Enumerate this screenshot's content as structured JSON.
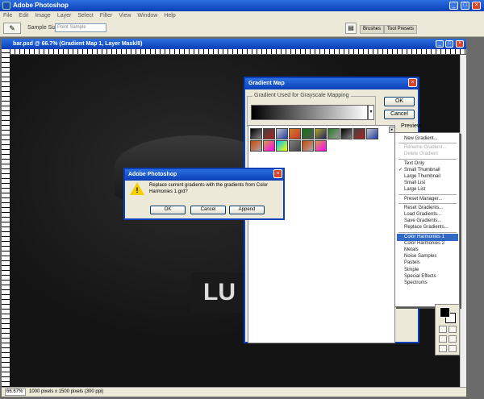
{
  "app": {
    "title": "Adobe Photoshop"
  },
  "menubar": [
    "File",
    "Edit",
    "Image",
    "Layer",
    "Select",
    "Filter",
    "View",
    "Window",
    "Help"
  ],
  "options": {
    "sample_size_label": "Sample Size:",
    "sample_size_value": "Point Sample",
    "tabs": [
      "Brushes",
      "Tool Presets"
    ]
  },
  "document": {
    "title": "bar.psd @ 66.7% (Gradient Map 1, Layer Mask/8)",
    "zoom": "66.67%",
    "info": "1000 pixels x 1500 pixels (300 ppi)",
    "sign_text": "LU"
  },
  "gradient_map": {
    "title": "Gradient Map",
    "group_label": "Gradient Used for Grayscale Mapping",
    "ok": "OK",
    "cancel": "Cancel",
    "preview": "Preview"
  },
  "swatches": {
    "row1": [
      "#000000",
      "#888888",
      "#444444",
      "#aa2222",
      "#c0c0c0",
      "#1f3faa",
      "#d08020",
      "#cc3333",
      "#117711",
      "#555555",
      "#aaaa22",
      "#222266",
      "#2a7a2a",
      "#999999"
    ],
    "row2": [
      "#cc4400",
      "#aaaaaa",
      "#d0a040",
      "#ff00ff",
      "#00c0ff",
      "#ffff00",
      "#808080",
      "#404040"
    ]
  },
  "menu": {
    "items": [
      {
        "label": "New Gradient...",
        "state": "normal"
      },
      {
        "sep": true
      },
      {
        "label": "Rename Gradient...",
        "state": "disabled"
      },
      {
        "label": "Delete Gradient",
        "state": "disabled"
      },
      {
        "sep": true
      },
      {
        "label": "Text Only",
        "state": "normal"
      },
      {
        "label": "Small Thumbnail",
        "state": "checked"
      },
      {
        "label": "Large Thumbnail",
        "state": "normal"
      },
      {
        "label": "Small List",
        "state": "normal"
      },
      {
        "label": "Large List",
        "state": "normal"
      },
      {
        "sep": true
      },
      {
        "label": "Preset Manager...",
        "state": "normal"
      },
      {
        "sep": true
      },
      {
        "label": "Reset Gradients...",
        "state": "normal"
      },
      {
        "label": "Load Gradients...",
        "state": "normal"
      },
      {
        "label": "Save Gradients...",
        "state": "normal"
      },
      {
        "label": "Replace Gradients...",
        "state": "normal"
      },
      {
        "sep": true
      },
      {
        "label": "Color Harmonies 1",
        "state": "selected"
      },
      {
        "label": "Color Harmonies 2",
        "state": "normal"
      },
      {
        "label": "Metals",
        "state": "normal"
      },
      {
        "label": "Noise Samples",
        "state": "normal"
      },
      {
        "label": "Pastels",
        "state": "normal"
      },
      {
        "label": "Simple",
        "state": "normal"
      },
      {
        "label": "Special Effects",
        "state": "normal"
      },
      {
        "label": "Spectrums",
        "state": "normal"
      }
    ]
  },
  "alert": {
    "title": "Adobe Photoshop",
    "message": "Replace current gradients with the gradients from Color Harmonies 1.grd?",
    "buttons": [
      "OK",
      "Cancel",
      "Append"
    ]
  }
}
